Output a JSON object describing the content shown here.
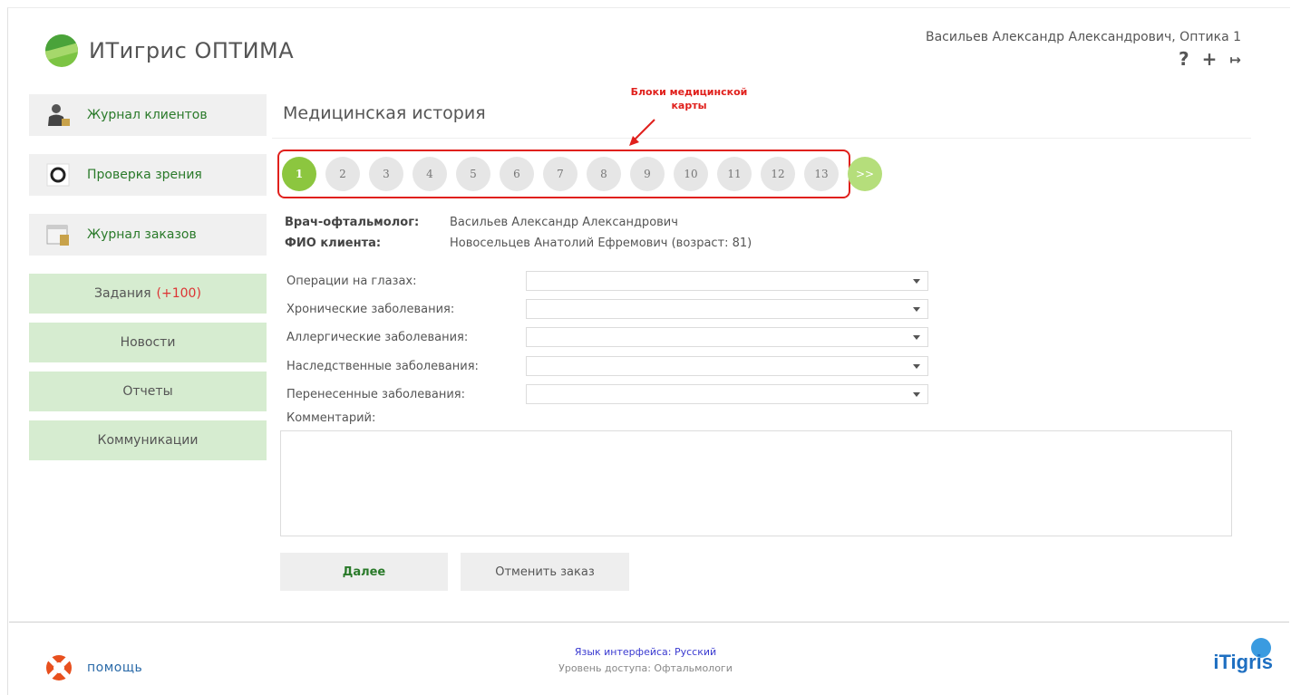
{
  "header": {
    "app_title": "ИТигрис ОПТИМА",
    "user": "Васильев Александр Александрович, Оптика 1",
    "icons": [
      "help-icon",
      "add-icon",
      "logout-icon"
    ],
    "icon_glyphs": {
      "help": "?",
      "add": "+",
      "logout": "↦"
    }
  },
  "sidebar": {
    "main_items": [
      {
        "label": "Журнал клиентов",
        "icon": "client-journal-icon"
      },
      {
        "label": "Проверка зрения",
        "icon": "vision-check-icon"
      },
      {
        "label": "Журнал заказов",
        "icon": "orders-journal-icon"
      }
    ],
    "sub_items": [
      {
        "label": "Задания",
        "count": "(+100)"
      },
      {
        "label": "Новости"
      },
      {
        "label": "Отчеты"
      },
      {
        "label": "Коммуникации"
      }
    ]
  },
  "main": {
    "title": "Медицинская история",
    "annotation": "Блоки медицинской карты",
    "steps": [
      "1",
      "2",
      "3",
      "4",
      "5",
      "6",
      "7",
      "8",
      "9",
      "10",
      "11",
      "12",
      "13"
    ],
    "active_step": "1",
    "next_label": ">>",
    "doctor_label": "Врач-офтальмолог:",
    "doctor_value": "Васильев Александр Александрович",
    "client_label": "ФИО клиента:",
    "client_value": "Новосельцев Анатолий Ефремович (возраст: 81)",
    "fields": [
      {
        "label": "Операции на глазах:",
        "value": ""
      },
      {
        "label": "Хронические заболевания:",
        "value": ""
      },
      {
        "label": "Аллергические заболевания:",
        "value": ""
      },
      {
        "label": "Наследственные заболевания:",
        "value": ""
      },
      {
        "label": "Перенесенные заболевания:",
        "value": ""
      }
    ],
    "comment_label": "Комментарий:",
    "comment_value": "",
    "btn_next": "Далее",
    "btn_cancel": "Отменить заказ"
  },
  "footer": {
    "help": "помощь",
    "language": "Язык интерфейса: Русский",
    "access_level": "Уровень доступа: Офтальмологи",
    "brand": "iTigris"
  },
  "colors": {
    "accent_green": "#8cc63f",
    "annotation_red": "#e0201c",
    "link_green": "#2a7a2a",
    "brand_blue": "#1e6fc1"
  }
}
